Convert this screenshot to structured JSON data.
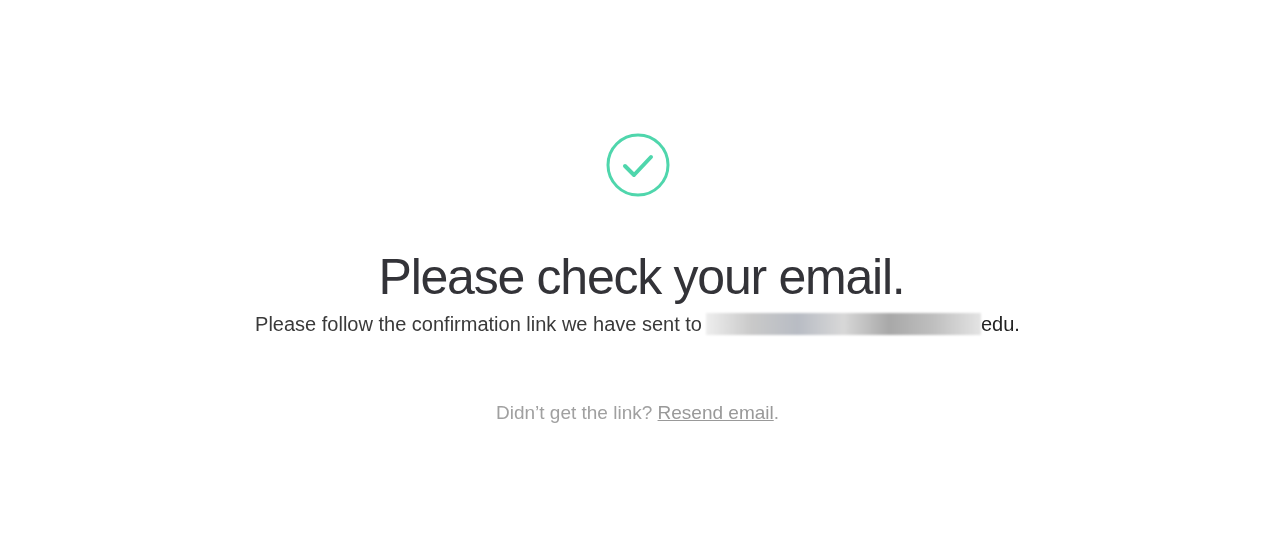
{
  "heading": "Please check your email.",
  "message": {
    "text": "Please follow the confirmation link we have sent to",
    "email_redacted": true,
    "email_visible": "edu",
    "end": "."
  },
  "resend": {
    "prompt": "Didn’t get the link?",
    "link": "Resend email",
    "end": "."
  }
}
